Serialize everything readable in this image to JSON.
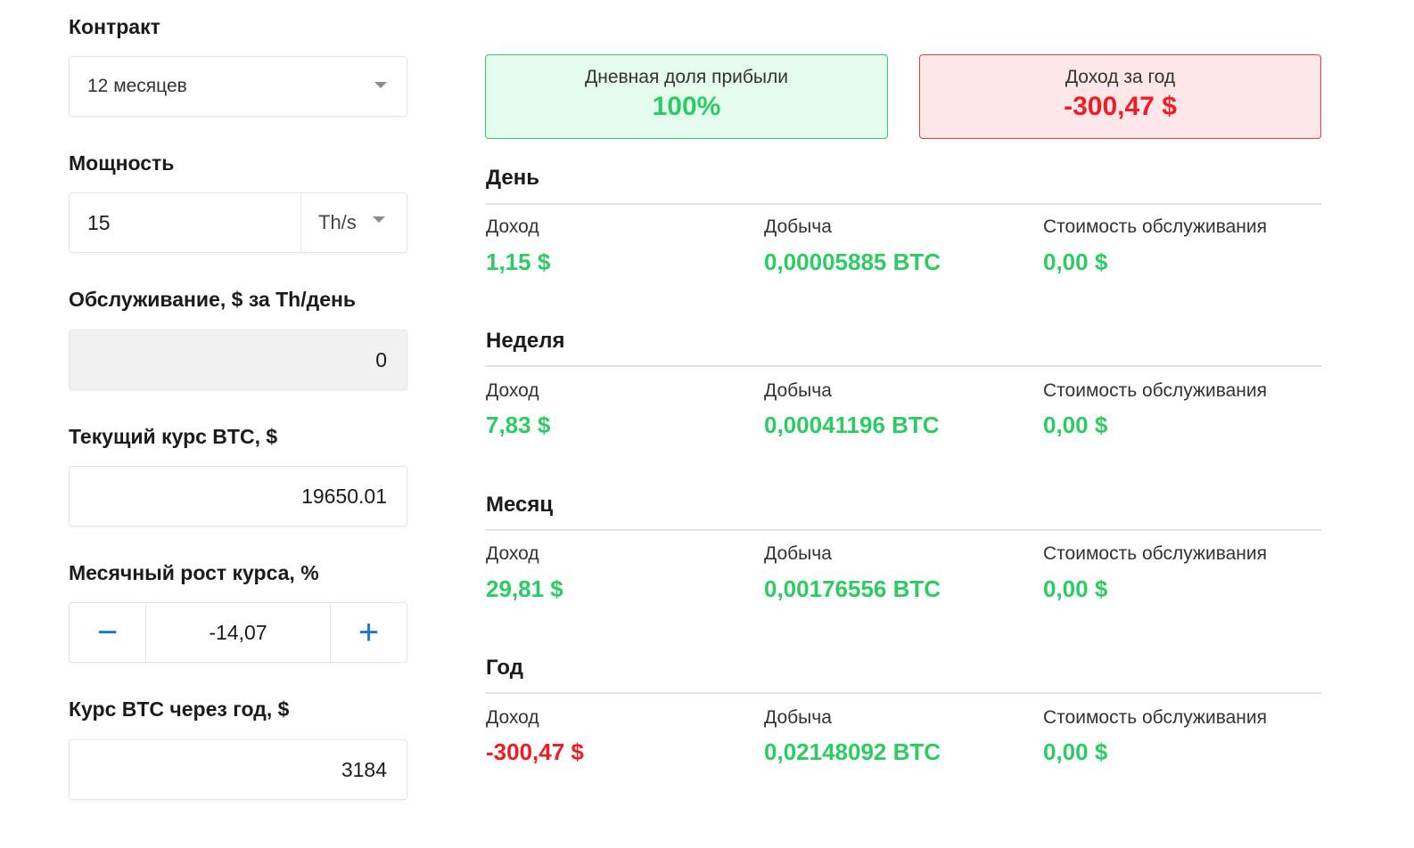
{
  "form": {
    "contract": {
      "label": "Контракт",
      "value": "12 месяцев"
    },
    "power": {
      "label": "Мощность",
      "value": "15",
      "unit": "Th/s"
    },
    "maintenance": {
      "label": "Обслуживание, $ за Th/день",
      "value": "0"
    },
    "btc_rate": {
      "label": "Текущий курс BTC, $",
      "value": "19650.01"
    },
    "monthly_growth": {
      "label": "Месячный рост курса, %",
      "value": "-14,07",
      "minus": "−",
      "plus": "+"
    },
    "btc_year": {
      "label": "Курс BTC через год, $",
      "value": "3184"
    }
  },
  "summary": {
    "daily_share": {
      "title": "Дневная доля прибыли",
      "value": "100%"
    },
    "year_income": {
      "title": "Доход за год",
      "value": "-300,47 $"
    }
  },
  "labels": {
    "income": "Доход",
    "mining": "Добыча",
    "maintenance_cost": "Стоимость обслуживания"
  },
  "periods": [
    {
      "title": "День",
      "income": "1,15 $",
      "mining": "0,00005885 BTC",
      "cost": "0,00 $"
    },
    {
      "title": "Неделя",
      "income": "7,83 $",
      "mining": "0,00041196 BTC",
      "cost": "0,00 $"
    },
    {
      "title": "Месяц",
      "income": "29,81 $",
      "mining": "0,00176556 BTC",
      "cost": "0,00 $"
    },
    {
      "title": "Год",
      "income": "-300,47 $",
      "mining": "0,02148092 BTC",
      "cost": "0,00 $"
    }
  ],
  "colors": {
    "positive": "#2bcc61",
    "negative": "#ee1c24",
    "accent": "#1976d2"
  }
}
